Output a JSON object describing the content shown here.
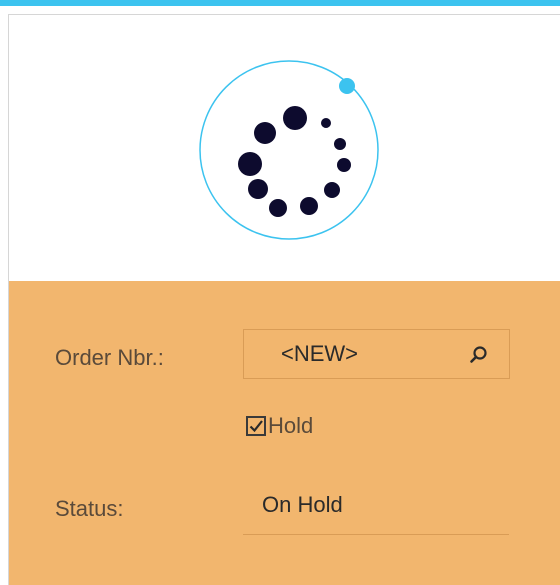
{
  "loader": {
    "spinner_icon": "loading-spinner-icon",
    "accent_color": "#3cc3ef",
    "dot_color": "#0d0b2e"
  },
  "form": {
    "background_color": "#f2b66e",
    "order_nbr": {
      "label": "Order Nbr.:",
      "value": "<NEW>",
      "icon": "search-icon"
    },
    "hold": {
      "label": "Hold",
      "checked": true
    },
    "status": {
      "label": "Status:",
      "value": "On Hold"
    }
  }
}
